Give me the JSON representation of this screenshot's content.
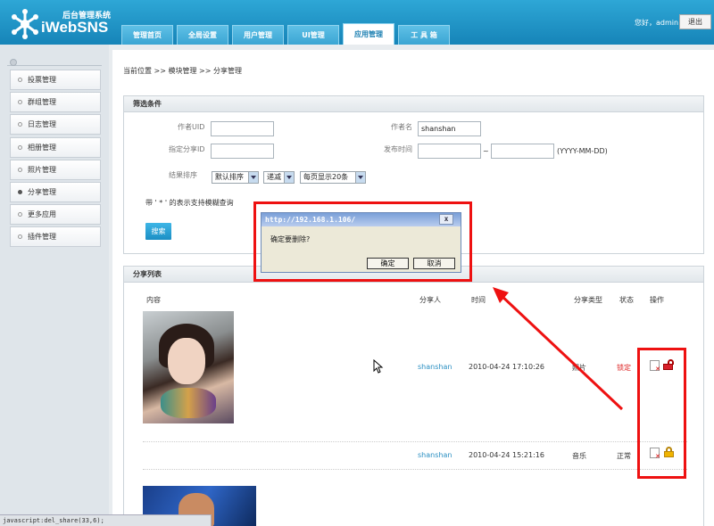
{
  "header": {
    "logo_sub": "后台管理系统",
    "logo_text": "iWebSNS",
    "greeting": "您好，admin",
    "logout": "退出",
    "nav": [
      {
        "label": "管理首页"
      },
      {
        "label": "全局设置"
      },
      {
        "label": "用户管理"
      },
      {
        "label": "UI管理"
      },
      {
        "label": "应用管理"
      },
      {
        "label": "工 具 箱"
      }
    ],
    "active_tab": "应用管理"
  },
  "sidebar": {
    "items": [
      {
        "label": "投票管理"
      },
      {
        "label": "群组管理"
      },
      {
        "label": "日志管理"
      },
      {
        "label": "相册管理"
      },
      {
        "label": "照片管理"
      },
      {
        "label": "分享管理"
      },
      {
        "label": "更多应用"
      },
      {
        "label": "插件管理"
      }
    ],
    "active_item": "分享管理"
  },
  "breadcrumb": "当前位置 >> 模块管理 >> 分享管理",
  "filter": {
    "title": "筛选条件",
    "author_uid_label": "作者UID",
    "author_uid_value": "",
    "author_name_label": "作者名",
    "author_name_value": "shanshan",
    "share_id_label": "指定分享ID",
    "share_id_value": "",
    "publish_time_label": "发布时间",
    "date_from": "",
    "date_sep": "~",
    "date_to": "",
    "date_format": "(YYYY-MM-DD)",
    "sort_label": "结果排序",
    "sort_by": "默认排序",
    "sort_order": "递减",
    "page_size": "每页显示20条",
    "hint": "带 ' * ' 的表示支持模糊查询",
    "search_button": "搜索"
  },
  "list": {
    "title": "分享列表",
    "headers": {
      "content": "内容",
      "sharer": "分享人",
      "time": "时间",
      "type": "分享类型",
      "status": "状态",
      "actions": "操作"
    },
    "rows": [
      {
        "sharer": "shanshan",
        "time": "2010-04-24 17:10:26",
        "type": "照片",
        "status": "锁定"
      },
      {
        "sharer": "shanshan",
        "time": "2010-04-24 15:21:16",
        "type": "音乐",
        "status": "正常"
      }
    ]
  },
  "dialog": {
    "title": "http://192.168.1.106/",
    "message": "确定要删除?",
    "ok": "确定",
    "cancel": "取消",
    "close": "x"
  },
  "statusbar": "javascript:del_share(33,6);",
  "colors": {
    "header": "#1684b8",
    "accent": "#2a8fc2",
    "highlight": "#ee1111",
    "locked": "#dd2222"
  }
}
